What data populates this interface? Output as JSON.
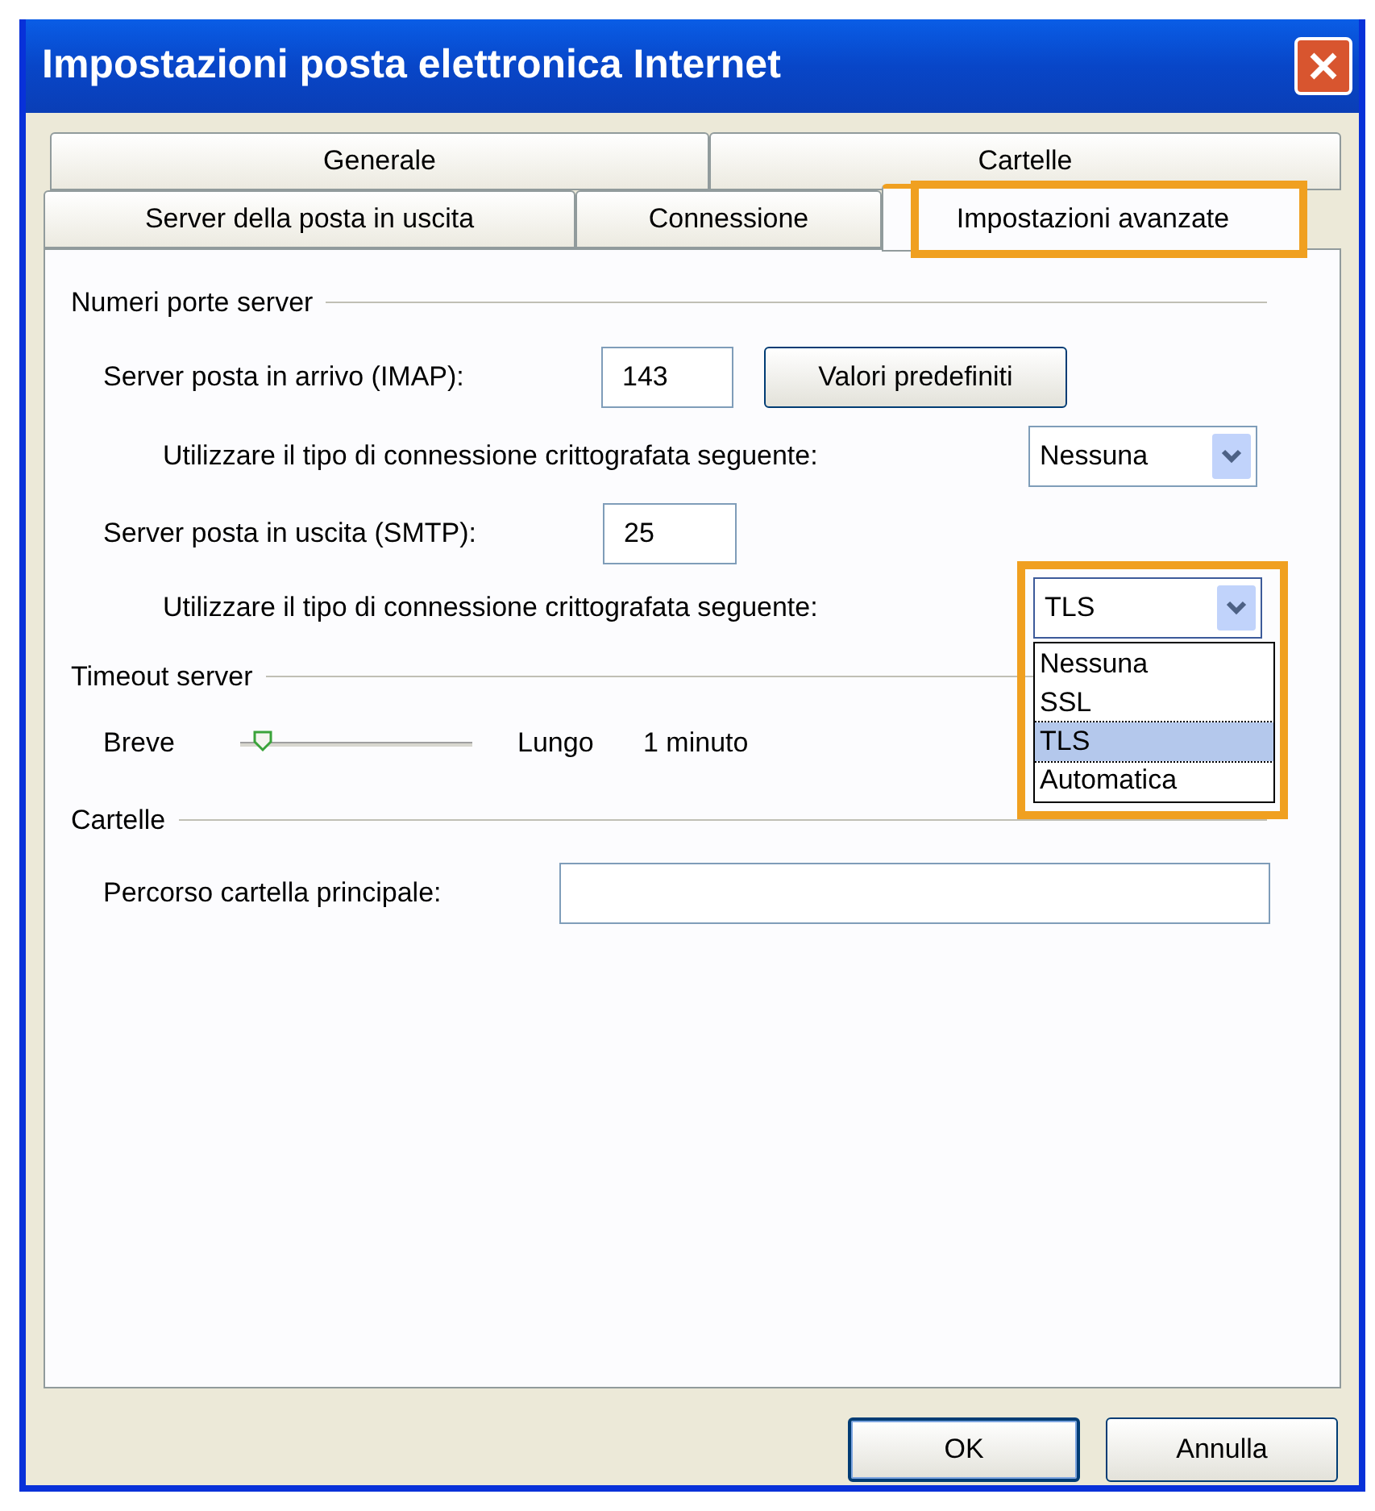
{
  "window": {
    "title": "Impostazioni posta elettronica Internet"
  },
  "tabs": [
    [
      {
        "label": "Generale",
        "selected": false
      },
      {
        "label": "Cartelle",
        "selected": false
      }
    ],
    [
      {
        "label": "Server della posta in uscita",
        "selected": false
      },
      {
        "label": "Connessione",
        "selected": false
      },
      {
        "label": "Impostazioni avanzate",
        "selected": true,
        "highlighted": true
      }
    ]
  ],
  "ports": {
    "heading": "Numeri porte server",
    "incoming": {
      "label": "Server posta in arrivo (IMAP):",
      "value": "143"
    },
    "defaults_button": "Valori predefiniti",
    "incoming_encryption": {
      "label": "Utilizzare il tipo di connessione crittografata seguente:",
      "value": "Nessuna",
      "expanded": false
    },
    "outgoing": {
      "label": "Server posta in uscita (SMTP):",
      "value": "25"
    },
    "outgoing_encryption": {
      "label": "Utilizzare il tipo di connessione crittografata seguente:",
      "value": "TLS",
      "expanded": true,
      "highlighted": true,
      "options": [
        {
          "label": "Nessuna",
          "selected": false
        },
        {
          "label": "SSL",
          "selected": false
        },
        {
          "label": "TLS",
          "selected": true
        },
        {
          "label": "Automatica",
          "selected": false
        }
      ]
    }
  },
  "timeout": {
    "heading": "Timeout server",
    "min_label": "Breve",
    "max_label": "Lungo",
    "level": 0.05,
    "reading": "1 minuto"
  },
  "folders": {
    "heading": "Cartelle",
    "root_label": "Percorso cartella principale:"
  },
  "buttons": [
    "OK",
    "Annulla"
  ]
}
